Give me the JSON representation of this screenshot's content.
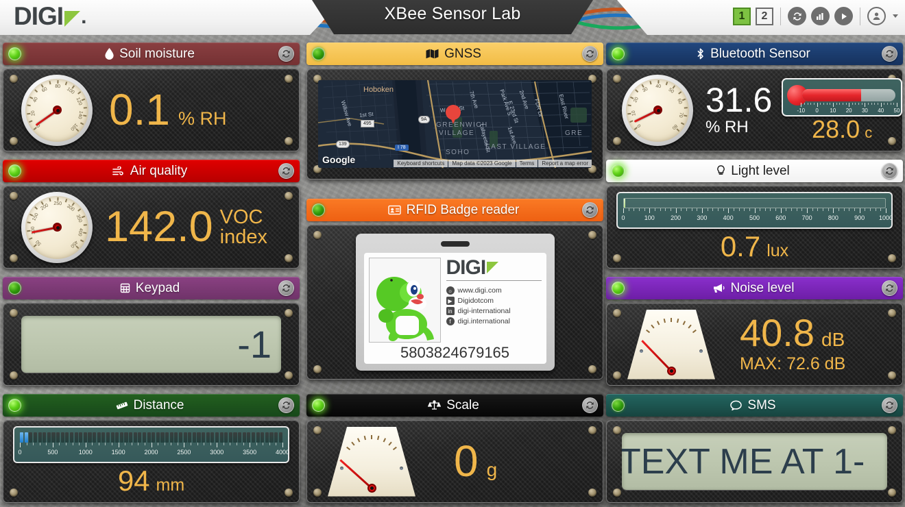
{
  "header": {
    "title": "XBee Sensor Lab",
    "logo_text": "DIGI",
    "page_buttons": [
      {
        "label": "1",
        "active": true
      },
      {
        "label": "2",
        "active": false
      }
    ],
    "tools": [
      {
        "name": "refresh-icon",
        "glyph": "↻"
      },
      {
        "name": "chart-icon",
        "glyph": "ὌA"
      },
      {
        "name": "play-icon",
        "glyph": "▶"
      },
      {
        "name": "user-icon",
        "glyph": "὆4"
      }
    ]
  },
  "panels": {
    "soil": {
      "title": "Soil moisture",
      "icon": "water-drop-icon",
      "value": "0.1",
      "unit": "% RH",
      "header_color": "#7b3436",
      "led": "on"
    },
    "air": {
      "title": "Air quality",
      "icon": "wind-icon",
      "value": "142.0",
      "unit_line1": "VOC",
      "unit_line2": "index",
      "header_color": "#cc0000",
      "led": "on"
    },
    "keypad": {
      "title": "Keypad",
      "icon": "calculator-icon",
      "value": "-1",
      "header_color": "#7b3a73",
      "led": "dim"
    },
    "distance": {
      "title": "Distance",
      "icon": "ruler-icon",
      "value": "94",
      "unit": "mm",
      "header_color": "#1c4d1c",
      "led": "on",
      "scale_ticks": [
        "0",
        "500",
        "1000",
        "1500",
        "2000",
        "2500",
        "3000",
        "3500",
        "4000"
      ],
      "scale_min": 0,
      "scale_max": 4000,
      "segments_total": 58,
      "segments_lit": 2
    },
    "gnss": {
      "title": "GNSS",
      "icon": "map-icon",
      "header_color": "#f3c košice",
      "header_color_hex": "#f5c council",
      "map": {
        "provider": "Google",
        "labels": [
          {
            "text": "Hoboken",
            "type": "town"
          },
          {
            "text": "GREENWICH VILLAGE",
            "type": "area"
          },
          {
            "text": "SOHO",
            "type": "area"
          },
          {
            "text": "EAST VILLAGE",
            "type": "area"
          },
          {
            "text": "GRE",
            "type": "area"
          },
          {
            "text": "W 14th St",
            "type": "street"
          },
          {
            "text": "7th Ave",
            "type": "street"
          },
          {
            "text": "Park Ave S",
            "type": "street"
          },
          {
            "text": "2nd Ave",
            "type": "street"
          },
          {
            "text": "E 23rd St",
            "type": "street"
          },
          {
            "text": "FDR Dr",
            "type": "street"
          },
          {
            "text": "East River",
            "type": "street"
          },
          {
            "text": "1st Ave",
            "type": "street"
          },
          {
            "text": "Lafayette St",
            "type": "street"
          },
          {
            "text": "1st St",
            "type": "street"
          },
          {
            "text": "Willow Ave",
            "type": "street"
          }
        ],
        "shields": [
          "9A",
          "495",
          "139",
          "I 78"
        ],
        "attribution": [
          "Keyboard shortcuts",
          "Map data ©2023 Google",
          "Terms",
          "Report a map error"
        ]
      },
      "led": "dim"
    },
    "rfid": {
      "title": "RFID Badge reader",
      "icon": "id-card-icon",
      "header_color": "#f26a1b",
      "led": "dim",
      "badge": {
        "logo_text": "DIGI",
        "id_number": "5803824679165",
        "links": [
          {
            "icon": "globe-icon",
            "text": "www.digi.com"
          },
          {
            "icon": "youtube-icon",
            "text": "Digidotcom"
          },
          {
            "icon": "linkedin-icon",
            "text": "digi-international"
          },
          {
            "icon": "facebook-icon",
            "text": "digi.international"
          }
        ]
      }
    },
    "scale": {
      "title": "Scale",
      "icon": "balance-scale-icon",
      "value": "0",
      "unit": "g",
      "header_color": "#0a0a0a",
      "led": "on"
    },
    "bluetooth": {
      "title": "Bluetooth Sensor",
      "icon": "bluetooth-icon",
      "header_color": "#1a3a6b",
      "led": "on",
      "humidity_value": "31.6",
      "humidity_unit": "% RH",
      "temp_value": "28.0",
      "temp_unit": "c",
      "thermo_ticks": [
        "-10",
        "0",
        "10",
        "20",
        "30",
        "40",
        "50"
      ],
      "thermo_min": -10,
      "thermo_max": 50,
      "thermo_current": 28
    },
    "light": {
      "title": "Light level",
      "icon": "lightbulb-icon",
      "value": "0.7",
      "unit": "lux",
      "header_color": "#ffffff",
      "header_text_dark": true,
      "led": "on",
      "scale_ticks": [
        "0",
        "100",
        "200",
        "300",
        "400",
        "500",
        "600",
        "700",
        "800",
        "900",
        "1000"
      ],
      "scale_min": 0,
      "scale_max": 1000,
      "current": 0.7
    },
    "noise": {
      "title": "Noise level",
      "icon": "megaphone-icon",
      "value": "40.8",
      "unit": "dB",
      "max_label": "MAX: 72.6 dB",
      "header_color": "#7a23b8",
      "led": "on"
    },
    "sms": {
      "title": "SMS",
      "icon": "chat-bubble-icon",
      "message": "TEXT ME AT 1-",
      "header_color": "#1d5550",
      "led": "dim"
    }
  }
}
